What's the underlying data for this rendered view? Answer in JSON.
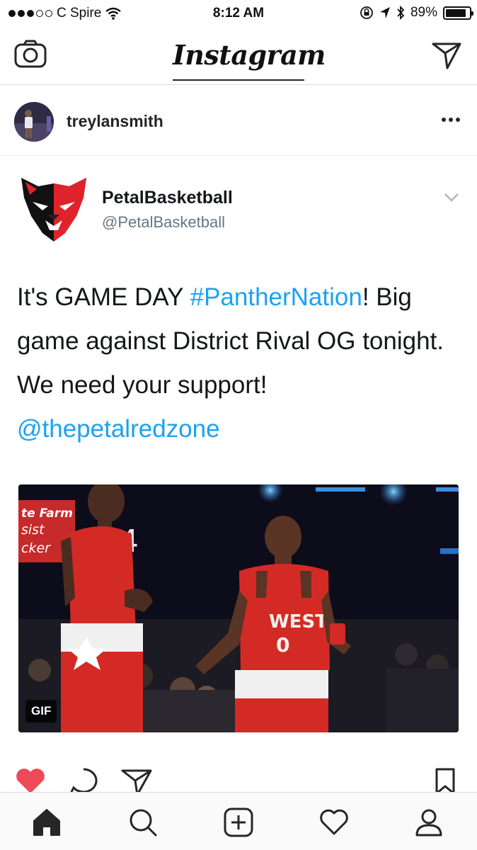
{
  "status_bar": {
    "carrier": "C Spire",
    "time": "8:12 AM",
    "battery_percent": "89%",
    "battery_level": 0.89,
    "signal_bars_filled": 3,
    "signal_bars_total": 5
  },
  "top_nav": {
    "logo": "Instagram"
  },
  "post": {
    "username": "treylansmith"
  },
  "tweet": {
    "display_name": "PetalBasketball",
    "handle": "@PetalBasketball",
    "text_part1": "It's GAME DAY ",
    "hashtag": "#PantherNation",
    "text_part2": "! Big game against District Rival OG tonight. We need your support!",
    "mention": "@thepetalredzone",
    "media_badge": "GIF",
    "jersey_text": "WEST",
    "jersey_number": "0",
    "bg_sign": "te Farm sist cker",
    "bg_number": "4"
  },
  "colors": {
    "like_red": "#ed4956",
    "link_blue": "#1da1f2",
    "panther_red": "#e0222b",
    "jersey_red": "#d42a25"
  },
  "icons": {
    "camera": "camera-icon",
    "send": "paper-plane-icon",
    "more": "more-dots-icon",
    "chevron": "chevron-down-icon",
    "like": "heart-filled-icon",
    "comment": "comment-bubble-icon",
    "share": "paper-plane-icon",
    "save": "bookmark-icon",
    "home": "home-icon",
    "search": "search-icon",
    "add": "plus-square-icon",
    "activity": "heart-outline-icon",
    "profile": "person-icon"
  }
}
